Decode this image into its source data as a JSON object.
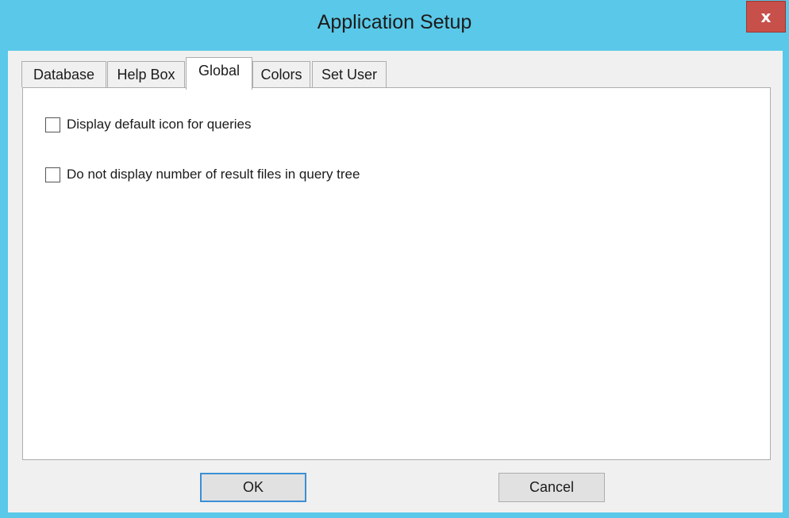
{
  "window": {
    "title": "Application Setup",
    "close_glyph": "x",
    "close_icon": "close-icon"
  },
  "tabs": [
    {
      "label": "Database",
      "active": false
    },
    {
      "label": "Help Box",
      "active": false
    },
    {
      "label": "Global",
      "active": true
    },
    {
      "label": "Colors",
      "active": false
    },
    {
      "label": "Set User",
      "active": false
    }
  ],
  "global": {
    "options": [
      {
        "label": "Display default icon for queries",
        "checked": false
      },
      {
        "label": "Do not display number of result files in query tree",
        "checked": false
      }
    ]
  },
  "buttons": {
    "ok_label": "OK",
    "cancel_label": "Cancel"
  },
  "colors": {
    "titlebar": "#5ac8e8",
    "close": "#c7504a",
    "default_button_border": "#3c8fd4"
  }
}
